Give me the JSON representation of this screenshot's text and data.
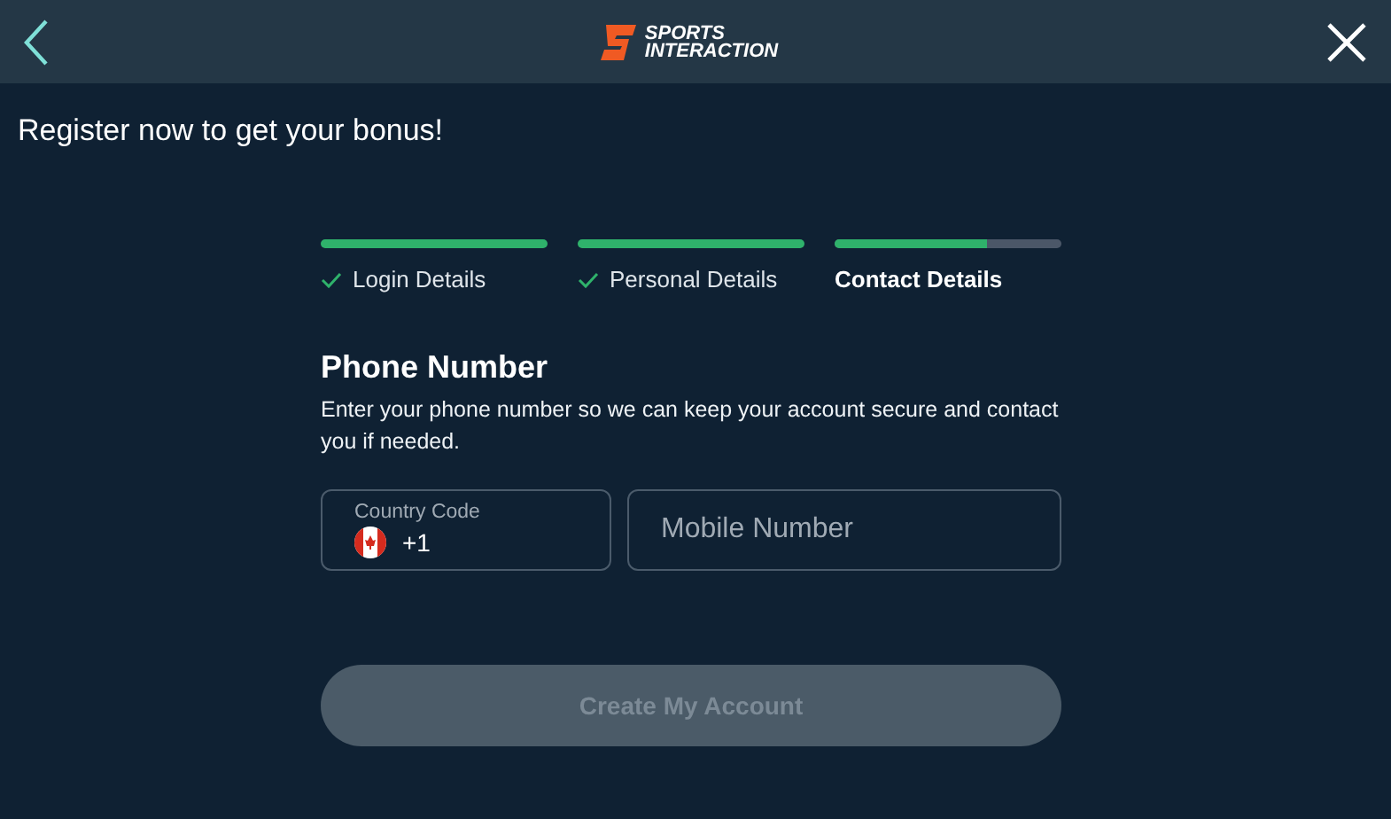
{
  "header": {
    "logo_line_1": "SPORTS",
    "logo_line_2": "INTERACTION"
  },
  "intro": "Register now to get your bonus!",
  "steps": [
    {
      "label": "Login Details",
      "level": 1,
      "done": true,
      "selected": false
    },
    {
      "label": "Personal Details",
      "level": 1,
      "done": true,
      "selected": false
    },
    {
      "label": "Contact Details",
      "level": 0.67,
      "done": false,
      "selected": true
    }
  ],
  "section": {
    "title": "Phone Number",
    "description": "Enter your phone number so we can keep your account secure and contact you if needed."
  },
  "country_code": {
    "label": "Country Code",
    "value": "+1"
  },
  "mobile": {
    "placeholder": "Mobile Number"
  },
  "submit": {
    "label": "Create My Account",
    "disabled": true
  }
}
